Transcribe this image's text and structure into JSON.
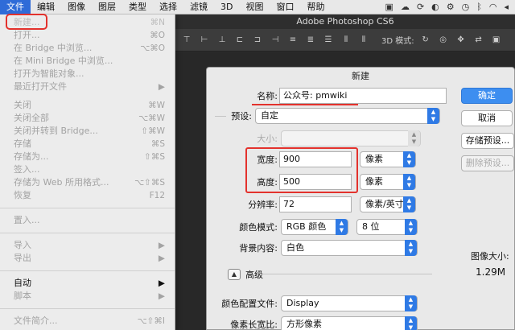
{
  "menubar": {
    "items": [
      "文件",
      "编辑",
      "图像",
      "图层",
      "类型",
      "选择",
      "滤镜",
      "3D",
      "视图",
      "窗口",
      "帮助"
    ],
    "tray_icons": [
      "app-icon",
      "cloud-icon",
      "sync-icon",
      "chat-icon",
      "settings-icon",
      "clock-icon",
      "bluetooth-icon",
      "wifi-icon",
      "volume-icon"
    ]
  },
  "file_menu": {
    "items": [
      {
        "label": "新建...",
        "shortcut": "⌘N"
      },
      {
        "label": "打开...",
        "shortcut": "⌘O"
      },
      {
        "label": "在 Bridge 中浏览...",
        "shortcut": "⌥⌘O"
      },
      {
        "label": "在 Mini Bridge 中浏览...",
        "shortcut": ""
      },
      {
        "label": "打开为智能对象...",
        "shortcut": ""
      },
      {
        "label": "最近打开文件",
        "shortcut": "▶"
      },
      {
        "label": "关闭",
        "shortcut": "⌘W"
      },
      {
        "label": "关闭全部",
        "shortcut": "⌥⌘W"
      },
      {
        "label": "关闭并转到 Bridge...",
        "shortcut": "⇧⌘W"
      },
      {
        "label": "存储",
        "shortcut": "⌘S"
      },
      {
        "label": "存储为...",
        "shortcut": "⇧⌘S"
      },
      {
        "label": "签入...",
        "shortcut": ""
      },
      {
        "label": "存储为 Web 所用格式...",
        "shortcut": "⌥⇧⌘S"
      },
      {
        "label": "恢复",
        "shortcut": "F12"
      },
      {
        "label": "置入...",
        "shortcut": ""
      },
      {
        "label": "导入",
        "shortcut": "▶"
      },
      {
        "label": "导出",
        "shortcut": "▶"
      },
      {
        "label": "自动",
        "shortcut": "▶"
      },
      {
        "label": "脚本",
        "shortcut": "▶"
      },
      {
        "label": "文件简介...",
        "shortcut": "⌥⇧⌘I"
      }
    ]
  },
  "app": {
    "title": "Adobe Photoshop CS6",
    "options_label": "3D 模式:"
  },
  "dialog": {
    "title": "新建",
    "name_label": "名称:",
    "name_value": "公众号: pmwiki",
    "preset_label": "预设:",
    "preset_value": "自定",
    "size_label": "大小:",
    "width_label": "宽度:",
    "width_value": "900",
    "width_unit": "像素",
    "height_label": "高度:",
    "height_value": "500",
    "height_unit": "像素",
    "resolution_label": "分辨率:",
    "resolution_value": "72",
    "resolution_unit": "像素/英寸",
    "color_mode_label": "颜色模式:",
    "color_mode_value": "RGB 颜色",
    "bit_depth_value": "8 位",
    "background_label": "背景内容:",
    "background_value": "白色",
    "advanced_label": "高级",
    "color_profile_label": "颜色配置文件:",
    "color_profile_value": "Display",
    "pixel_aspect_label": "像素长宽比:",
    "pixel_aspect_value": "方形像素",
    "ok_label": "确定",
    "cancel_label": "取消",
    "save_preset_label": "存储预设...",
    "delete_preset_label": "删除预设...",
    "image_size_label": "图像大小:",
    "image_size_value": "1.29M"
  },
  "colors": {
    "accent": "#2f7ae5",
    "highlight": "#e3322d",
    "menu_active": "#2f6bd8"
  }
}
